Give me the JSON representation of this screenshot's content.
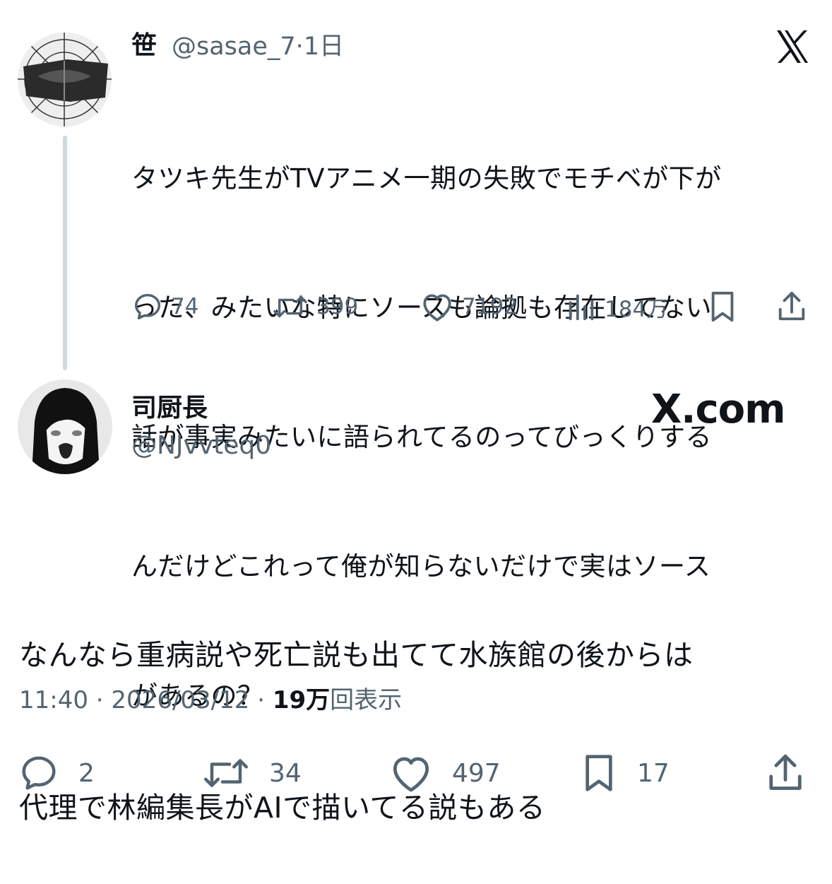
{
  "tweet1": {
    "name": "笹",
    "handle": "@sasae_7",
    "time": "1日",
    "text": "タツキ先生がTVアニメ一期の失敗でモチベが下がった、みたいな特にソースも論拠も存在してない話が事実みたいに語られてるのってびっくりするんだけどこれって俺が知らないだけで実はソースがあるの？",
    "lines": [
      "タツキ先生がTVアニメ一期の失敗でモチベが下が",
      "った、みたいな特にソースも論拠も存在してない",
      "話が事実みたいに語られてるのってびっくりする",
      "んだけどこれって俺が知らないだけで実はソース",
      "があるの？"
    ],
    "replies": "74",
    "retweets": "399",
    "likes": "7192",
    "views": "184万",
    "icons": [
      "reply-icon",
      "retweet-icon",
      "like-icon",
      "views-icon",
      "bookmark-icon",
      "share-icon"
    ]
  },
  "x_logo": "X",
  "tweet2": {
    "name": "司厨長",
    "handle": "@NJvvteq0",
    "brand": "X.com",
    "lines": [
      "なんなら重病説や死亡説も出てて水族館の後からは",
      "代理で林編集長がAIで描いてる説もある"
    ],
    "time": "11:40",
    "date": "2026/03/12",
    "views_count": "19万",
    "views_label": "回表示",
    "replies": "2",
    "retweets": "34",
    "likes": "497",
    "bookmarks": "17",
    "icons": [
      "reply-icon",
      "retweet-icon",
      "like-icon",
      "bookmark-icon",
      "share-icon"
    ]
  },
  "colors": {
    "text": "#0f1419",
    "secondary": "#536471",
    "thread_line": "#cfd9de"
  }
}
